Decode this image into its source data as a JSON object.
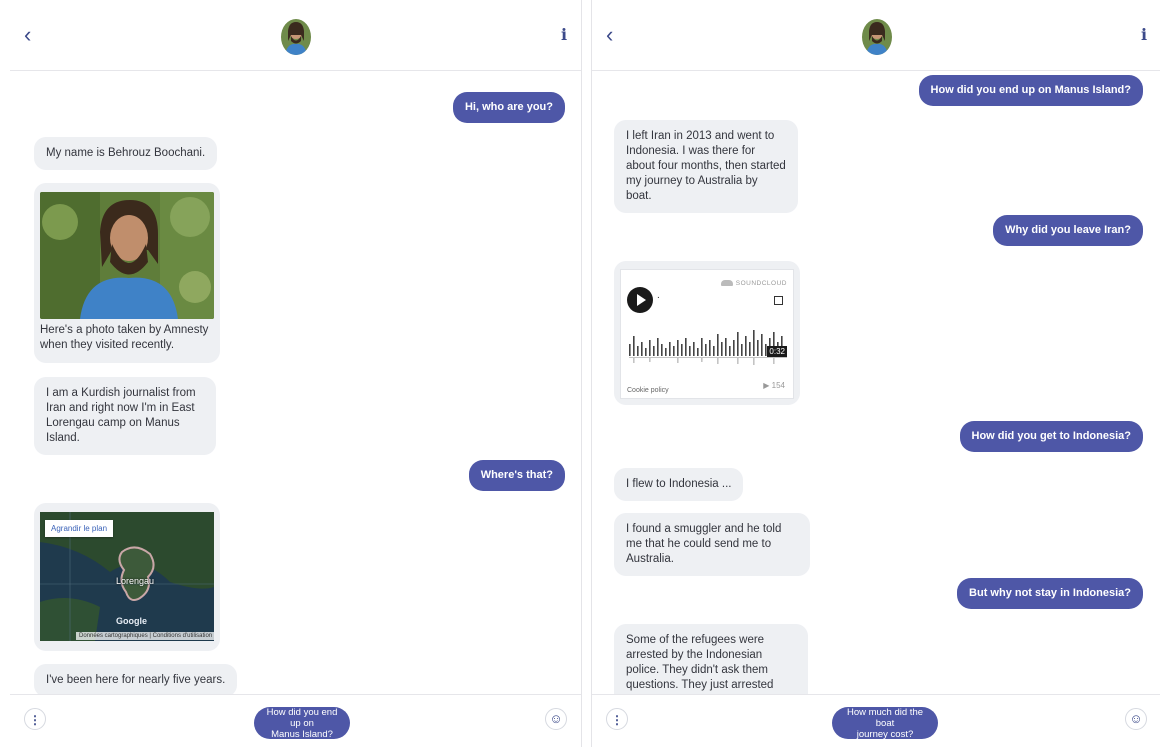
{
  "colors": {
    "accent": "#4e57a7",
    "bot_bubble": "#eef0f3",
    "icon": "#3c4a8a"
  },
  "left": {
    "header": {
      "back_icon": "chevron-left-icon",
      "back": "‹",
      "info": "i"
    },
    "messages": {
      "m1": "Hi, who are you?",
      "m2": "My name is Behrouz Boochani.",
      "m3_caption": "Here's a photo taken by Amnesty when they visited recently.",
      "m4": "I am a Kurdish journalist from Iran and right now I'm in East Lorengau camp on Manus Island.",
      "m5": "Where's that?",
      "map": {
        "enlarge": "Agrandir le plan",
        "place": "Lorengau",
        "logo": "Google",
        "attribution": "Données cartographiques | Conditions d'utilisation"
      },
      "m6": "I've been here for nearly five years."
    },
    "footer": {
      "menu": "⋮",
      "emoji": "☺",
      "suggest_line1": "How did you end up on",
      "suggest_line2": "Manus Island?"
    }
  },
  "right": {
    "header": {
      "back": "‹",
      "info": "i"
    },
    "messages": {
      "r1": "How did you end up on Manus Island?",
      "r2": "I left Iran in 2013 and went to Indonesia. I was there for about four months, then started my journey to Australia by boat.",
      "r3": "Why did you leave Iran?",
      "audio": {
        "brand": "SOUNDCLOUD",
        "time": "0:32",
        "cookie": "Cookie policy",
        "plays": "▶ 154",
        "dot": "."
      },
      "r4": "How did you get to Indonesia?",
      "r5": "I flew to Indonesia ...",
      "r6": "I found a smuggler and he told me that he could send me to Australia.",
      "r7": "But why not stay in Indonesia?",
      "r8": "Some of the refugees were arrested by the Indonesian police. They didn't ask them questions. They just arrested them and deported them."
    },
    "footer": {
      "menu": "⋮",
      "emoji": "☺",
      "suggest_line1": "How much did the boat",
      "suggest_line2": "journey cost?"
    }
  }
}
